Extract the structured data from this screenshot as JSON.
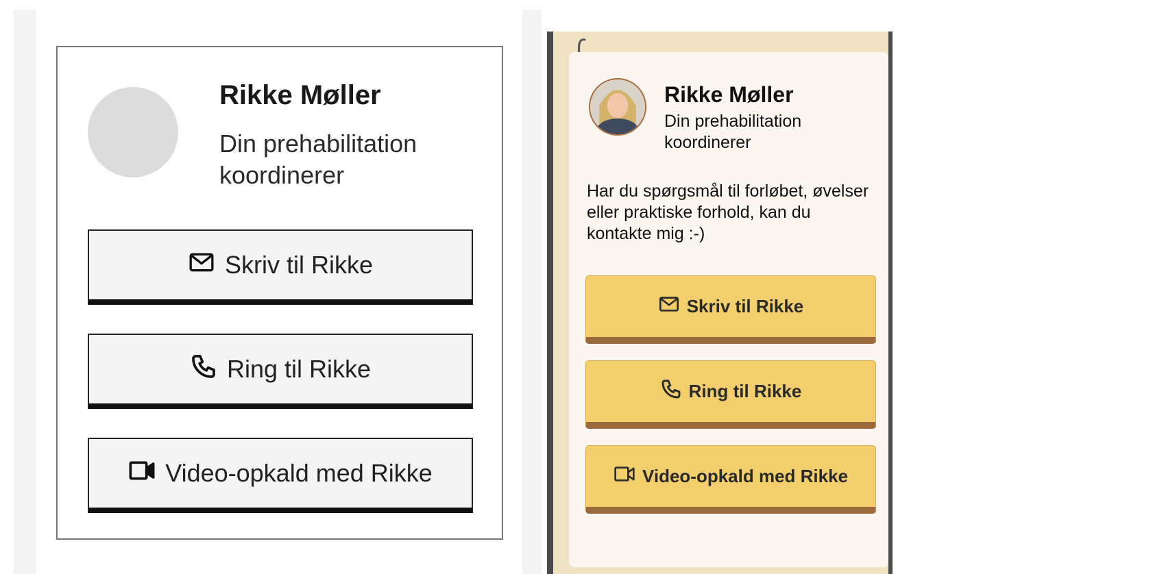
{
  "contact": {
    "name": "Rikke Møller",
    "role": "Din prehabilitation koordinerer",
    "message": "Har du spørgsmål til forløbet, øvelser eller praktiske forhold, kan du kontakte mig :-)",
    "buttons": {
      "write": {
        "label": "Skriv til Rikke",
        "icon": "mail-icon"
      },
      "call": {
        "label": "Ring til Rikke",
        "icon": "phone-icon"
      },
      "video": {
        "label": "Video-opkald med Rikke",
        "icon": "video-camera-icon"
      }
    }
  },
  "colors": {
    "wireframe_button_bg": "#f4f4f4",
    "styled_button_bg": "#f2cf6c",
    "styled_button_shadow": "#9a6a3c",
    "styled_panel_bg": "#fcf6f1",
    "styled_frame_bg": "#efe3c4"
  }
}
